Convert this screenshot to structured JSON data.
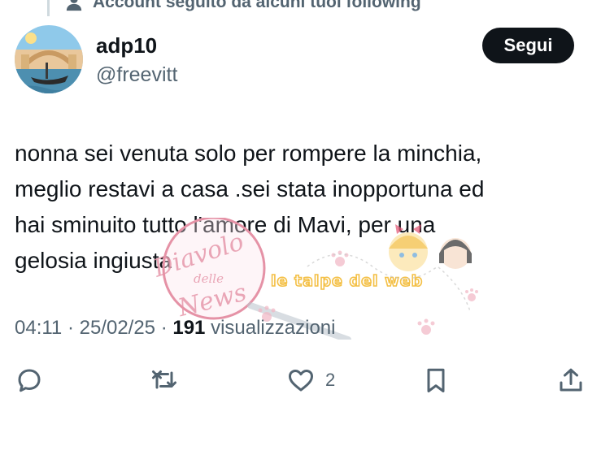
{
  "context": {
    "text": "Account seguito da alcuni tuoi following",
    "icon": "person-icon"
  },
  "author": {
    "display_name": "adp10",
    "handle": "@freevitt",
    "avatar_icon": "venice-avatar"
  },
  "follow_button": {
    "label": "Segui"
  },
  "tweet": {
    "lines": [
      "nonna sei venuta solo per rompere la minchia,",
      "meglio restavi a casa .sei stata inopportuna ed",
      "hai sminuito tutto l'amore di Mavi, per una",
      "gelosia ingiusta"
    ]
  },
  "meta": {
    "time": "04:11",
    "separator": " · ",
    "date": "25/02/25",
    "views_count": "191",
    "views_label": " visualizzazioni"
  },
  "actions": {
    "reply": {
      "icon": "reply-icon",
      "count": ""
    },
    "retweet": {
      "icon": "retweet-icon",
      "count": ""
    },
    "like": {
      "icon": "heart-icon",
      "count": "2"
    },
    "bookmark": {
      "icon": "bookmark-icon",
      "count": ""
    },
    "share": {
      "icon": "share-icon",
      "count": ""
    }
  },
  "watermark": {
    "script_top": "Diavolo",
    "script_mid": "delle",
    "script_bottom": "News",
    "brand": "le talpe del web"
  },
  "colors": {
    "text": "#0f1419",
    "secondary": "#536471",
    "button_bg": "#0f1419",
    "button_text": "#ffffff",
    "border": "#cfd9de"
  }
}
